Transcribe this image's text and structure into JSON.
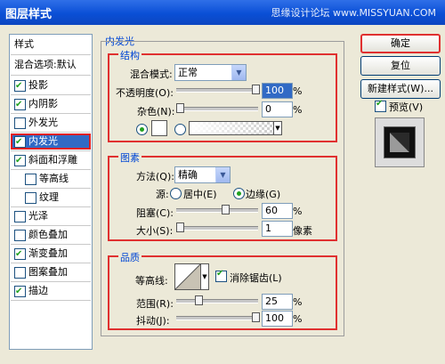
{
  "window": {
    "title": "图层样式",
    "watermark": "思缘设计论坛 www.MISSYUAN.COM"
  },
  "left_panel": {
    "header": "样式",
    "blend_default": "混合选项:默认",
    "items": [
      {
        "label": "投影",
        "checked": true
      },
      {
        "label": "内阴影",
        "checked": true
      },
      {
        "label": "外发光",
        "checked": false
      },
      {
        "label": "内发光",
        "checked": true,
        "selected": true
      },
      {
        "label": "斜面和浮雕",
        "checked": true
      },
      {
        "label": "等高线",
        "checked": false,
        "indent": true
      },
      {
        "label": "纹理",
        "checked": false,
        "indent": true
      },
      {
        "label": "光泽",
        "checked": false
      },
      {
        "label": "颜色叠加",
        "checked": false
      },
      {
        "label": "渐变叠加",
        "checked": true
      },
      {
        "label": "图案叠加",
        "checked": false
      },
      {
        "label": "描边",
        "checked": true
      }
    ]
  },
  "panel_title": "内发光",
  "structure": {
    "legend": "结构",
    "blend_mode_label": "混合模式:",
    "blend_mode_value": "正常",
    "opacity_label": "不透明度(O):",
    "opacity_value": "100",
    "opacity_unit": "%",
    "opacity_fraction": 1.0,
    "noise_label": "杂色(N):",
    "noise_value": "0",
    "noise_unit": "%",
    "noise_fraction": 0.0,
    "color_mode": "solid"
  },
  "elements": {
    "legend": "图素",
    "method_label": "方法(Q):",
    "method_value": "精确",
    "source_label": "源:",
    "source_center": "居中(E)",
    "source_edge": "边缘(G)",
    "source_selected": "edge",
    "choke_label": "阻塞(C):",
    "choke_value": "60",
    "choke_unit": "%",
    "choke_fraction": 0.6,
    "size_label": "大小(S):",
    "size_value": "1",
    "size_unit": "像素",
    "size_fraction": 0.0
  },
  "quality": {
    "legend": "品质",
    "contour_label": "等高线:",
    "antialias_label": "消除锯齿(L)",
    "antialias_checked": true,
    "range_label": "范围(R):",
    "range_value": "25",
    "range_unit": "%",
    "range_fraction": 0.25,
    "jitter_label": "抖动(J):",
    "jitter_value": "100",
    "jitter_unit": "%",
    "jitter_fraction": 1.0
  },
  "buttons": {
    "ok": "确定",
    "reset": "复位",
    "new_style": "新建样式(W)...",
    "preview": "预览(V)",
    "preview_checked": true
  },
  "colors": {
    "title_bar": "#0a4fd6",
    "selection": "#316ac5",
    "highlight_box": "#e03030",
    "check": "#21a121"
  }
}
